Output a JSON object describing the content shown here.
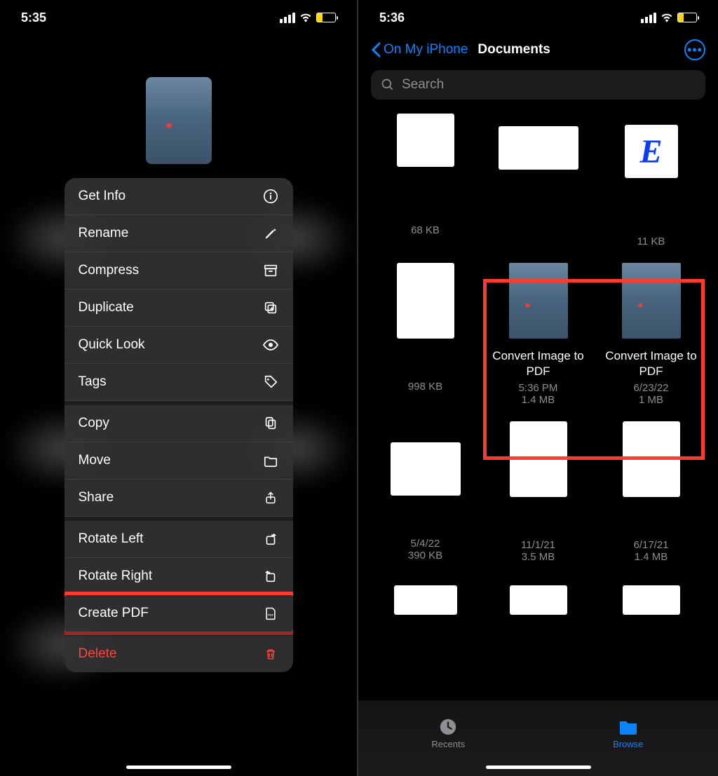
{
  "left": {
    "time": "5:35",
    "menu": {
      "get_info": "Get Info",
      "rename": "Rename",
      "compress": "Compress",
      "duplicate": "Duplicate",
      "quick_look": "Quick Look",
      "tags": "Tags",
      "copy": "Copy",
      "move": "Move",
      "share": "Share",
      "rotate_left": "Rotate Left",
      "rotate_right": "Rotate Right",
      "create_pdf": "Create PDF",
      "delete": "Delete"
    }
  },
  "right": {
    "time": "5:36",
    "back": "On My iPhone",
    "title": "Documents",
    "search_placeholder": "Search",
    "files": [
      {
        "name": "",
        "meta1": "",
        "meta2": "68 KB"
      },
      {
        "name": "",
        "meta1": "",
        "meta2": ""
      },
      {
        "name": "",
        "meta1": "",
        "meta2": "11 KB"
      },
      {
        "name": "",
        "meta1": "",
        "meta2": "998 KB"
      },
      {
        "name": "Convert Image to PDF",
        "meta1": "5:36 PM",
        "meta2": "1.4 MB"
      },
      {
        "name": "Convert Image to PDF",
        "meta1": "6/23/22",
        "meta2": "1 MB"
      },
      {
        "name": "",
        "meta1": "5/4/22",
        "meta2": "390 KB"
      },
      {
        "name": "",
        "meta1": "11/1/21",
        "meta2": "3.5 MB"
      },
      {
        "name": "",
        "meta1": "6/17/21",
        "meta2": "1.4 MB"
      }
    ],
    "tabs": {
      "recents": "Recents",
      "browse": "Browse"
    }
  }
}
